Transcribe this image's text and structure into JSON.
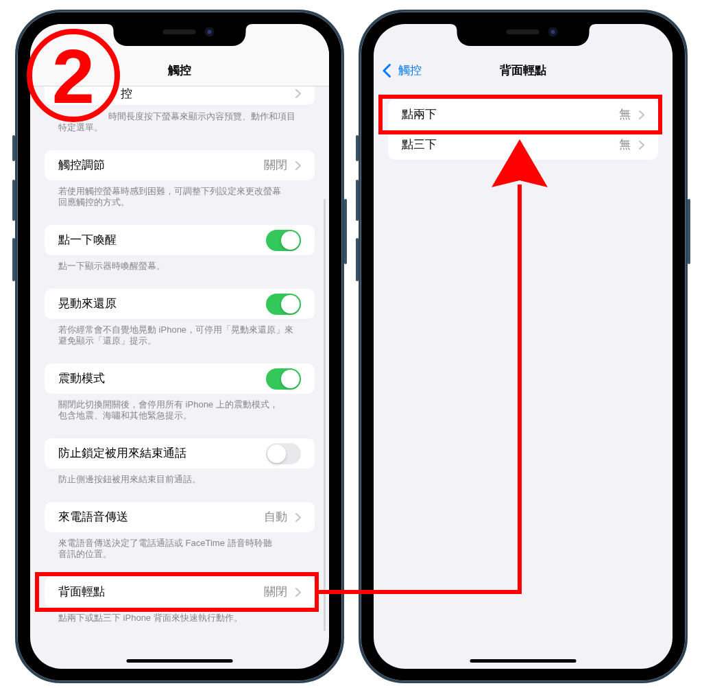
{
  "annotations": {
    "step_number": "2"
  },
  "screens": [
    {
      "scrolled": true,
      "nav": {
        "title": "觸控"
      },
      "groups": [
        {
          "kind": "partial",
          "rows": [
            {
              "kind": "link",
              "label": "控",
              "highlighted": false
            }
          ],
          "footer": [
            "時間長度按下螢幕來顯示內容預覽、動作和項目",
            "特定選單。"
          ]
        },
        {
          "kind": "full",
          "rows": [
            {
              "kind": "link",
              "label": "觸控調節",
              "value": "關閉",
              "highlighted": false
            }
          ],
          "footer": [
            "若使用觸控螢幕時感到困難，可調整下列設定來更改螢幕",
            "回應觸控的方式。"
          ]
        },
        {
          "kind": "full",
          "rows": [
            {
              "kind": "toggle",
              "label": "點一下喚醒",
              "on": true,
              "highlighted": false
            }
          ],
          "footer": [
            "點一下顯示器時喚醒螢幕。"
          ]
        },
        {
          "kind": "full",
          "rows": [
            {
              "kind": "toggle",
              "label": "晃動來還原",
              "on": true,
              "highlighted": false
            }
          ],
          "footer": [
            "若你經常會不自覺地晃動 iPhone，可停用「晃動來還原」來",
            "避免顯示「還原」提示。"
          ]
        },
        {
          "kind": "full",
          "rows": [
            {
              "kind": "toggle",
              "label": "震動模式",
              "on": true,
              "highlighted": false
            }
          ],
          "footer": [
            "關閉此切換開關後，會停用所有 iPhone 上的震動模式，",
            "包含地震、海嘯和其他緊急提示。"
          ]
        },
        {
          "kind": "full",
          "rows": [
            {
              "kind": "toggle",
              "label": "防止鎖定被用來結束通話",
              "on": false,
              "highlighted": false
            }
          ],
          "footer": [
            "防止側邊按鈕被用來結束目前通話。"
          ]
        },
        {
          "kind": "full",
          "rows": [
            {
              "kind": "link",
              "label": "來電語音傳送",
              "value": "自動",
              "highlighted": false
            }
          ],
          "footer": [
            "來電語音傳送決定了電話通話或 FaceTime 語音時聆聽",
            "音訊的位置。"
          ]
        },
        {
          "kind": "full",
          "rows": [
            {
              "kind": "link",
              "label": "背面輕點",
              "value": "關閉",
              "highlighted": true
            }
          ],
          "footer": [
            "點兩下或點三下 iPhone 背面來快速執行動作。"
          ]
        }
      ]
    },
    {
      "scrolled": false,
      "nav": {
        "back": "觸控",
        "title": "背面輕點"
      },
      "groups": [
        {
          "kind": "full",
          "rows": [
            {
              "kind": "link",
              "label": "點兩下",
              "value": "無",
              "highlighted": true
            },
            {
              "kind": "link",
              "label": "點三下",
              "value": "無",
              "highlighted": false
            }
          ]
        }
      ]
    }
  ]
}
